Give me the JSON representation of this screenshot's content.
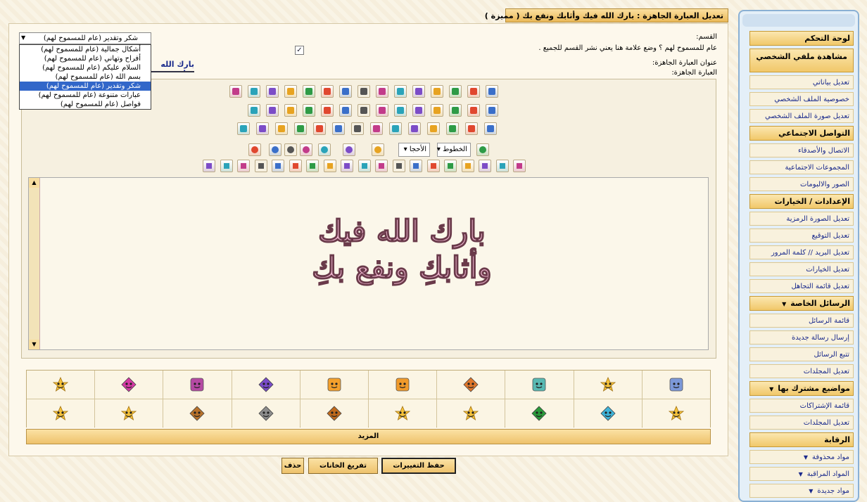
{
  "page": {
    "title": "تعديل العبارة الجاهزة : بارك الله فيك وأثابك ونفع بك ( مميزة )"
  },
  "form": {
    "section_label": "القسم:",
    "general_note": "عام للمسموح لهم ؟ وضع علامة هنا يعني نشر القسم للجميع .",
    "title_label": "عنوان العبارة الجاهزة:",
    "title_value": "بارك الله فيك",
    "content_label": "العبارة الجاهزة:",
    "general_checked": true
  },
  "dropdown": {
    "selected": "شكر وتقدير (عام للمسموح لهم)",
    "options": [
      "أشكال جمالية (عام للمسموح لهم)",
      "أفراح وتهاني (عام للمسموح لهم)",
      "السلام عليكم (عام للمسموح لهم)",
      "بسم الله (عام للمسموح لهم)",
      "شكر وتقدير (عام للمسموح لهم)",
      "عبارات متنوعة (عام للمسموح لهم)",
      "فواصل (عام للمسموح لهم)"
    ],
    "selected_index": 4
  },
  "editor": {
    "font_select": "الخطوط",
    "size_select": "الأحجا",
    "content_line1": "بارك الله فيك",
    "content_line2": "وأثابكِ ونفع بكِ"
  },
  "toolbar_row1": [
    "image",
    "image2",
    "gallery",
    "gallery2",
    "flash",
    "clock",
    "youtube",
    "itunes",
    "facebook",
    "firefox",
    "table",
    "media",
    "abcd",
    "quote-frame",
    "pen"
  ],
  "toolbar_row2": [
    "doc",
    "key",
    "book",
    "hyperlink",
    "font-a",
    "line",
    "insert",
    "delete",
    "cut",
    "paste",
    "comment",
    "ltr",
    "rtl",
    "justify"
  ],
  "toolbar_row3": [
    "user",
    "spoiler",
    "box",
    "frame",
    "window",
    "hand",
    "chart",
    "star1",
    "star2",
    "dots",
    "stop",
    "warning",
    "info",
    "close"
  ],
  "toolbar_row4_icons": [
    "font-color",
    "text-color",
    "smiley",
    "arrow-left",
    "arrow-right",
    "spell",
    "resize",
    "format"
  ],
  "toolbar_row5_icons": [
    "box1",
    "box2",
    "box3",
    "box4",
    "comment",
    "film",
    "mail",
    "globe1",
    "globe2",
    "indent",
    "outdent",
    "list-ul",
    "list-ol",
    "align-right",
    "align-center",
    "align-left",
    "underline",
    "italic",
    "bold"
  ],
  "smilies": [
    {
      "shape": "star",
      "color": "#f5c23a"
    },
    {
      "shape": "diamond",
      "color": "#d43aa5"
    },
    {
      "shape": "square",
      "color": "#b54aa3"
    },
    {
      "shape": "diamond",
      "color": "#7a4cc9"
    },
    {
      "shape": "square",
      "color": "#f4a02c"
    },
    {
      "shape": "square",
      "color": "#f09a2a"
    },
    {
      "shape": "diamond",
      "color": "#e0782c"
    },
    {
      "shape": "square",
      "color": "#58b9b2"
    },
    {
      "shape": "star",
      "color": "#f5c23a"
    },
    {
      "shape": "square",
      "color": "#7c98d8"
    },
    {
      "shape": "star",
      "color": "#f5c23a"
    },
    {
      "shape": "star",
      "color": "#f5c23a"
    },
    {
      "shape": "diamond",
      "color": "#b8722b"
    },
    {
      "shape": "diamond",
      "color": "#8d8d8d"
    },
    {
      "shape": "diamond",
      "color": "#c06a1c"
    },
    {
      "shape": "star",
      "color": "#f5c23a"
    },
    {
      "shape": "star",
      "color": "#f5c23a"
    },
    {
      "shape": "diamond",
      "color": "#2a9a3a"
    },
    {
      "shape": "diamond",
      "color": "#3fb3d8"
    },
    {
      "shape": "star",
      "color": "#f5c23a"
    }
  ],
  "more_label": "المزيد",
  "buttons": {
    "save": "حفظ التغييرات",
    "reset": "تفريغ الخانات",
    "delete": "حذف"
  },
  "sidebar": {
    "control_panel": "لوحة التحكم",
    "view_profile": "مشاهدة ملفي الشخصي",
    "group1": [
      "تعديل بياناتي",
      "خصوصية الملف الشخصي",
      "تعديل صورة الملف الشخصي"
    ],
    "social_head": "التواصل الاجتماعي",
    "social": [
      "الاتصال والأصدقاء",
      "المجموعات الاجتماعية",
      "الصور والالبومات"
    ],
    "settings_head": "الإعدادات / الخيارات",
    "settings": [
      "تعديل الصورة الرمزية",
      "تعديل التوقيع",
      "تعديل البريد // كلمة المرور",
      "تعديل الخيارات",
      "تعديل قائمة التجاهل"
    ],
    "pm_head": "الرسائل الخاصة",
    "pm": [
      "قائمة الرسائل",
      "إرسال رسالة جديدة",
      "تتبع الرسائل",
      "تعديل المجلدات"
    ],
    "subs_head": "مواضيع مشترك بها",
    "subs": [
      "قائمة الإشتراكات",
      "تعديل المجلدات"
    ],
    "mod_head": "الرقابة",
    "mod": [
      "مواد محذوفة",
      "المواد المراقبة",
      "مواد جديدة"
    ]
  }
}
